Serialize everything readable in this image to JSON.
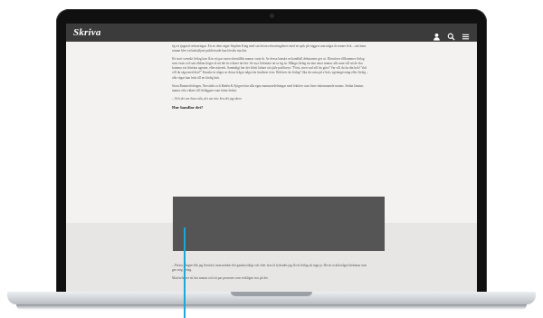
{
  "site": {
    "logo": "Skriva",
    "icons": [
      "user-icon",
      "search-icon",
      "menu-icon"
    ]
  },
  "article": {
    "paragraphs": [
      "ég ett tjugotal refuseringar. Ett av dem säger Stephen King med sin första refuseringsbrev med en spik på väggen som några år senare fick – när hans roman blev en bästsäljare publicerade han förstås mycket.",
      "Ett stort svenskt förlag kan få in ett par tusen obeställda manus varje år. Av dessa kanske en handfull debutanter ges ut. Därutöver tillkommer förlag som vuxit och satt ribban högre så att det är svårare än förr för nya författare att ta sig in. Många förlag tar inte emot manus alls utan vill att de ska komma via litterära agenter, eller nätverk. Samtidigt har det blivit lättare att själv publicera: ”Först, men vad vill du göra? Var vill du ha din bok? Vad vill du säga med den?” Kanske är några av dessa frågor något du funderar över. Behöver du förlag? Ska du satsa på e-bok, egenutgivning eller förlag – alla vägar kan leda till en färdig bok.",
      "Stora Bonnierförlagen, Norstedts och Rabén & Sjögren har alla egna manusavdelningar med lektörer som läser inkommande manus. Sedan lämnas manus ofta vidare till förläggare som fattar beslut.",
      "– Och det var bara nån, det var inte bra det jag skrev."
    ],
    "subhead": "Hur handlar det?",
    "paragraphs_after": [
      "– Första gången blir jag förstörd, man märker det ganska tidigt och efter fyra år lyckades jag få ett förlag att säga ja. Det är också några lärdomar som gav mig förlag.",
      "Man behöver ett bra manus och ett par personer som verkligen tror på det."
    ]
  }
}
